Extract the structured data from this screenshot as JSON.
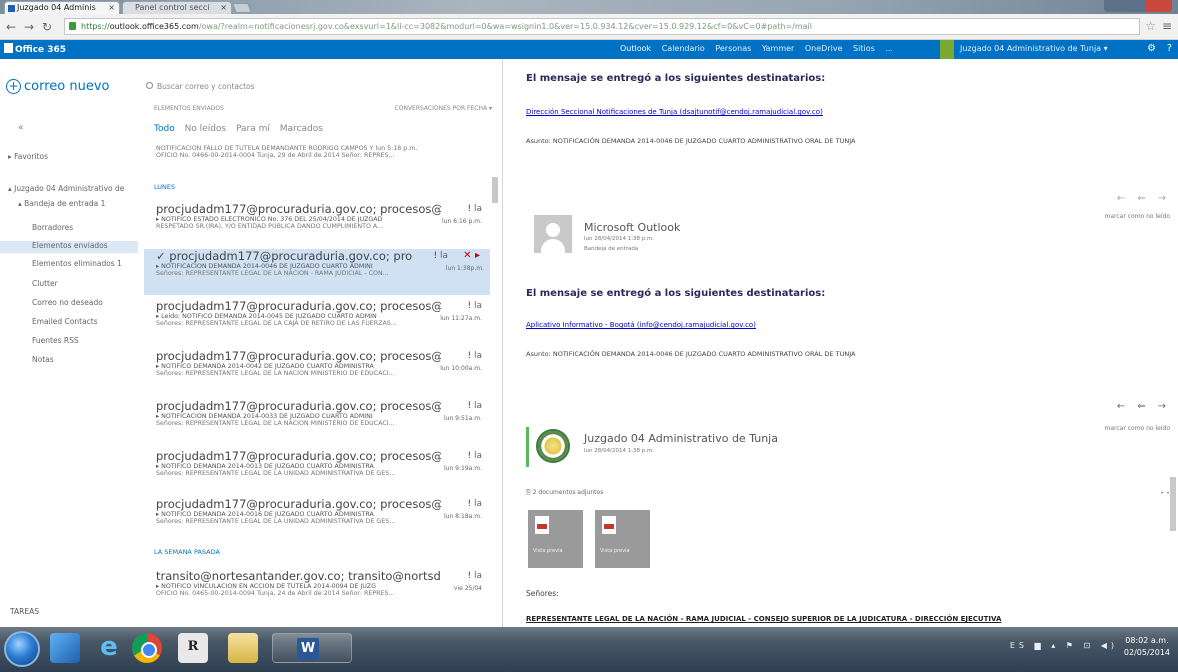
{
  "browser": {
    "tabs": [
      {
        "label": "Juzgado 04 Adminis"
      },
      {
        "label": "Panel control secci"
      }
    ],
    "url_scheme": "https://",
    "url_host": "outlook.office365.com",
    "url_rest": "/owa/?realm=notificacionesrj.gov.co&exsvurl=1&ll-cc=3082&modurl=0&wa=wsignin1.0&ver=15.0.934.12&cver=15.0.929.12&cf=0&vC=0#path=/mail"
  },
  "o365": {
    "brand": "Office 365",
    "nav": [
      "Outlook",
      "Calendario",
      "Personas",
      "Yammer",
      "OneDrive",
      "Sitios",
      "..."
    ],
    "user": "Juzgado 04 Administrativo de Tunja",
    "colors": {
      "bar": "#0072c6",
      "accent_green": "#7aa831"
    }
  },
  "folders": {
    "new_mail": "correo nuevo",
    "collapse_icon": "«",
    "favoritos": "▸ Favoritos",
    "account": "▴ Juzgado 04 Administrativo de",
    "items": [
      {
        "label": "▴ Bandeja de entrada  1"
      },
      {
        "label": "Borradores"
      },
      {
        "label": "Elementos enviados"
      },
      {
        "label": "Elementos eliminados  1"
      },
      {
        "label": "Clutter"
      },
      {
        "label": "Correo no deseado"
      },
      {
        "label": "Emailed Contacts"
      },
      {
        "label": "Fuentes RSS"
      },
      {
        "label": "Notas"
      }
    ],
    "tareas": "TAREAS"
  },
  "list": {
    "search_placeholder": "Buscar correo y contactos",
    "header_left": "ELEMENTOS ENVIADOS",
    "header_right": "CONVERSACIONES POR FECHA ▾",
    "filters": [
      "Todo",
      "No leídos",
      "Para mí",
      "Marcados"
    ],
    "top_truncated_subject": "NOTIFICACION FALLO DE TUTELA DEMANDANTE RODRIGO CAMPOS Y  lun 5:18 p.m.",
    "top_truncated_preview": "OFICIO No. 0466-00-2014-0004 Tunja, 29 de Abril de 2014   Señor: REPRES...",
    "group_lunes": "LUNES",
    "group_semana": "LA SEMANA PASADA",
    "messages": [
      {
        "from": "procjudadm177@procuraduria.gov.co; procesos@",
        "flag": "! ",
        "count": "la",
        "subject": "▸ NOTIFICO ESTADO ELECTRONICO No. 376 DEL 25/04/2014 DE JUZGAD",
        "time": "lun 6:16 p.m.",
        "preview": "RESPETADO SR.(IRA), Y/O ENTIDAD PUBLICA  DANDO CUMPLIMIENTO A..."
      },
      {
        "from": "✓ procjudadm177@procuraduria.gov.co; pro",
        "flag": "! ",
        "count": "la",
        "subject": "▸ NOTIFICACION DEMANDA 2014-0046 DE JUZGADO CUARTO ADMINI",
        "time": "lun 1:38p.m.",
        "preview": "Señores: REPRESENTANTE LEGAL DE LA NACIÓN - RAMA JUDICIAL - CON..."
      },
      {
        "from": "procjudadm177@procuraduria.gov.co; procesos@",
        "flag": "! ",
        "count": "la",
        "subject": "▸ Leído: NOTIFICO DEMANDA 2014-0045 DE JUZGADO CUARTO ADMIN",
        "time": "lun 11:27a.m.",
        "preview": "Señores: REPRESENTANTE LEGAL DE LA CAJA DE RETIRO DE LAS FUERZAS..."
      },
      {
        "from": "procjudadm177@procuraduria.gov.co; procesos@",
        "flag": "! ",
        "count": "la",
        "subject": "▸ NOTIFICO DEMANDA 2014-0042 DE JUZGADO CUARTO ADMINISTRA",
        "time": "lun 10:00a.m.",
        "preview": "Señores: REPRESENTANTE LEGAL DE LA NACIÓN MINISTERIO DE EDUCACI..."
      },
      {
        "from": "procjudadm177@procuraduria.gov.co; procesos@",
        "flag": "! ",
        "count": "la",
        "subject": "▸ NOTIFICACION DEMANDA 2014-0033 DE JUZGADO CUARTO ADMINI",
        "time": "lun 9:51a.m.",
        "preview": "Señores: REPRESENTANTE LEGAL DE LA NACIÓN MINISTERIO DE EDUCACI..."
      },
      {
        "from": "procjudadm177@procuraduria.gov.co; procesos@",
        "flag": "! ",
        "count": "la",
        "subject": "▸ NOTIFICO DEMANDA 2014-0013 DE JUZGADO CUARTO ADMINISTRA",
        "time": "lun 9:19a.m.",
        "preview": "Señores: REPRESENTANTE LEGAL DE LA UNIDAD ADMINISTRATIVA DE GES..."
      },
      {
        "from": "procjudadm177@procuraduria.gov.co; procesos@",
        "flag": "! ",
        "count": "la",
        "subject": "▸ NOTIFICO DEMANDA 2014-0016 DE JUZGADO CUARTO ADMINISTRA",
        "time": "lun 8:18a.m.",
        "preview": "Señores: REPRESENTANTE LEGAL DE LA UNIDAD ADMINISTRATIVA DE GES..."
      },
      {
        "from": "transito@nortesantander.gov.co; transito@nortsd",
        "flag": "! ",
        "count": "la",
        "subject": "▸ NOTIFICO VINCULACION EN ACCION DE TUTELA 2014-0094 DE JUZG",
        "time": "vie 25/04",
        "preview": "OFICIO No. 0465-00-2014-0094 Tunja, 24 de Abril de 2014  Señor: REPRES..."
      }
    ]
  },
  "reading": {
    "heading": "El mensaje se entregó a los siguientes destinatarios:",
    "recipient1": "Dirección Seccional Notificaciones de Tunja (dsajtunotif@cendoj.ramajudicial.gov.co)",
    "subject_line": "Asunto: NOTIFICACIÓN DEMANDA 2014-0046 DE JUZGADO CUARTO ADMINISTRATIVO ORAL DE TUNJA",
    "mark_unread": "marcar como no leído",
    "ms_sender": "Microsoft Outlook",
    "ms_date": "lun 28/04/2014 1:38 p.m.",
    "ms_folder": "Bandeja de entrada",
    "recipient2": "Aplicativo Informativo - Bogotá (info@cendoj.ramajudicial.gov.co)",
    "j_sender": "Juzgado 04 Administrativo de Tunja",
    "j_date": "lun 28/04/2014 1:38 p.m.",
    "attachments_label": "⎘ 2 documentos adjuntos",
    "attachments_more": "• •",
    "attachment_caption": "Vista previa",
    "greeting": "Señores:",
    "bottom_line": "REPRESENTANTE LEGAL DE LA NACIÓN - RAMA JUDICIAL - CONSEJO SUPERIOR DE LA JUDICATURA - DIRECCIÓN EJECUTIVA"
  },
  "taskbar": {
    "tray": "ES ▆ ▴ ⚑ ⊡ ◀)",
    "time": "08:02 a.m.",
    "date": "02/05/2014"
  }
}
